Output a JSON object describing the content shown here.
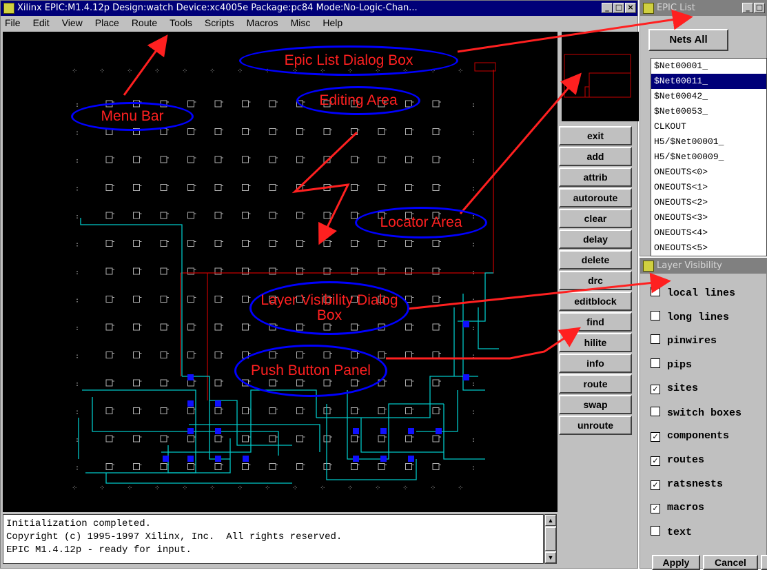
{
  "main_window": {
    "title": "Xilinx EPIC:M1.4.12p Design:watch Device:xc4005e Package:pc84 Mode:No-Logic-Chan...",
    "menu": [
      "File",
      "Edit",
      "View",
      "Place",
      "Route",
      "Tools",
      "Scripts",
      "Macros",
      "Misc",
      "Help"
    ],
    "buttons": [
      "exit",
      "add",
      "attrib",
      "autoroute",
      "clear",
      "delay",
      "delete",
      "drc",
      "editblock",
      "find",
      "hilite",
      "info",
      "route",
      "swap",
      "unroute"
    ],
    "console": [
      "Initialization completed.",
      "Copyright (c) 1995-1997 Xilinx, Inc.  All rights reserved.",
      "EPIC M1.4.12p - ready for input."
    ]
  },
  "epic_list": {
    "title": "EPIC List",
    "nets_button": "Nets All",
    "selected_index": 1,
    "items": [
      "$Net00001_",
      "$Net00011_",
      "$Net00042_",
      "$Net00053_",
      "CLKOUT",
      "H5/$Net00001_",
      "H5/$Net00009_",
      "ONEOUTS<0>",
      "ONEOUTS<1>",
      "ONEOUTS<2>",
      "ONEOUTS<3>",
      "ONEOUTS<4>",
      "ONEOUTS<5>"
    ]
  },
  "layer_visibility": {
    "title": "Layer Visibility",
    "items": [
      {
        "label": "local lines",
        "checked": false
      },
      {
        "label": "long lines",
        "checked": false
      },
      {
        "label": "pinwires",
        "checked": false
      },
      {
        "label": "pips",
        "checked": false
      },
      {
        "label": "sites",
        "checked": true
      },
      {
        "label": "switch boxes",
        "checked": false
      },
      {
        "label": "components",
        "checked": true
      },
      {
        "label": "routes",
        "checked": true
      },
      {
        "label": "ratsnests",
        "checked": true
      },
      {
        "label": "macros",
        "checked": true
      },
      {
        "label": "text",
        "checked": false
      }
    ],
    "apply": "Apply",
    "cancel": "Cancel"
  },
  "callouts": {
    "epic_list": "Epic List Dialog Box",
    "menu_bar": "Menu Bar",
    "editing_area": "Editing Area",
    "locator_area": "Locator Area",
    "layer_visibility": "Layer Visibility Dialog Box",
    "push_button": "Push Button Panel"
  },
  "colors": {
    "route": "#00c8c8",
    "ratsnest": "#c80000",
    "component": "#1010ff",
    "annotation": "#ff2020",
    "callout_border": "#0000ff"
  }
}
